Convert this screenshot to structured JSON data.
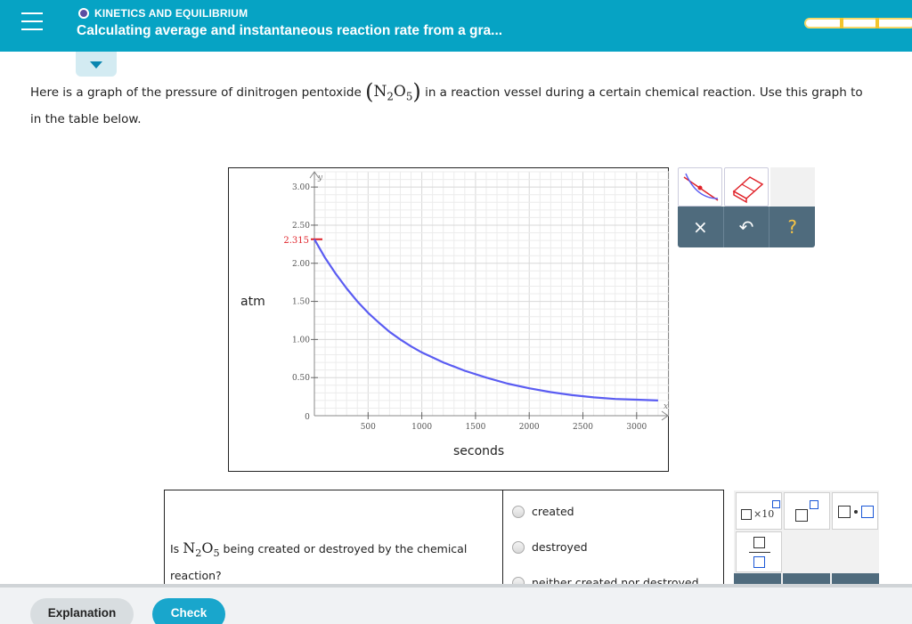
{
  "header": {
    "topic": "KINETICS AND EQUILIBRIUM",
    "title": "Calculating average and instantaneous reaction rate from a gra..."
  },
  "prompt": {
    "part1": "Here is a graph of the pressure of dinitrogen pentoxide",
    "formula_N": "N",
    "formula_sub1": "2",
    "formula_O": "O",
    "formula_sub2": "5",
    "part2": "in a reaction vessel during a certain chemical reaction. Use this graph to",
    "line2": "in the table below."
  },
  "chart_data": {
    "type": "line",
    "ylabel": "atm",
    "xlabel": "seconds",
    "x_axis_letter": "x",
    "y_axis_letter": "y",
    "xlim": [
      0,
      3300
    ],
    "ylim": [
      0,
      3.2
    ],
    "x_ticks": [
      "500",
      "1000",
      "1500",
      "2000",
      "2500",
      "3000"
    ],
    "x_tick_values": [
      500,
      1000,
      1500,
      2000,
      2500,
      3000
    ],
    "y_ticks": [
      "0.50",
      "1.00",
      "1.50",
      "2.00",
      "2.50",
      "3.00"
    ],
    "y_tick_values": [
      0.5,
      1.0,
      1.5,
      2.0,
      2.5,
      3.0
    ],
    "origin_label": "0",
    "marked_value": {
      "label": "2.315",
      "value": 2.315,
      "color": "#e0232a"
    },
    "series": [
      {
        "color": "#5a5cf2",
        "x": [
          0,
          100,
          200,
          300,
          400,
          500,
          600,
          700,
          800,
          900,
          1000,
          1200,
          1400,
          1600,
          1800,
          2000,
          2200,
          2400,
          2600,
          2800,
          3000,
          3200
        ],
        "y": [
          2.315,
          2.07,
          1.86,
          1.67,
          1.5,
          1.35,
          1.22,
          1.1,
          1.0,
          0.91,
          0.83,
          0.7,
          0.59,
          0.5,
          0.42,
          0.36,
          0.31,
          0.27,
          0.24,
          0.22,
          0.21,
          0.2
        ]
      }
    ],
    "grid": true
  },
  "tools": {
    "clear": "×",
    "undo": "↶",
    "help": "?"
  },
  "table": {
    "question_pre": "Is",
    "formula_N": "N",
    "formula_sub1": "2",
    "formula_O": "O",
    "formula_sub2": "5",
    "question_post": "being created or destroyed by the chemical",
    "question_line2": "reaction?",
    "options": [
      "created",
      "destroyed",
      "neither created nor destroyed"
    ]
  },
  "math_palette": {
    "times10": "×10"
  },
  "footer": {
    "explanation": "Explanation",
    "check": "Check"
  }
}
